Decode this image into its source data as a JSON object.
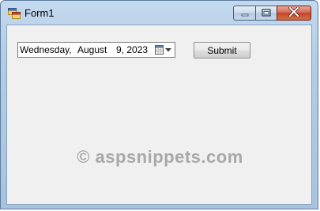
{
  "window": {
    "title": "Form1",
    "icons": {
      "app": "form-app-icon",
      "minimize": "minimize-icon",
      "maximize": "maximize-icon",
      "close": "close-icon"
    },
    "colors": {
      "close_button": "#c6452d",
      "client_background": "#f0f0f0",
      "frame": "#b3cce6"
    }
  },
  "form": {
    "date_picker": {
      "day_of_week": "Wednesday,",
      "month": "August",
      "date_year": "9, 2023",
      "dropdown_icon": "calendar-dropdown-icon"
    },
    "submit_label": "Submit"
  },
  "watermark": "© aspsnippets.com"
}
